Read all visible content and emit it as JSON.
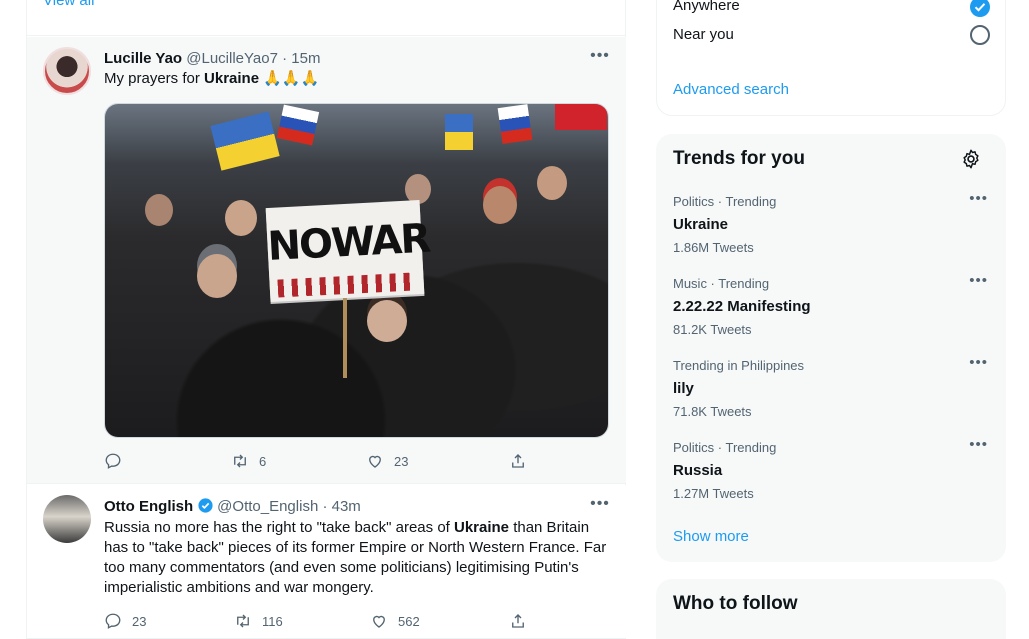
{
  "timeline": {
    "view_all": "View all",
    "tweets": [
      {
        "author": "Lucille Yao",
        "handle": "@LucilleYao7 · 15m",
        "text_before": "My prayers for ",
        "text_bold": "Ukraine",
        "text_after": " 🙏🙏🙏",
        "media": {
          "sign_text": "NOWAR"
        },
        "reply_count": "",
        "retweet_count": "6",
        "like_count": "23"
      },
      {
        "author": "Otto English",
        "handle": "@Otto_English · 43m",
        "verified": true,
        "text_before": "Russia no more has the right to \"take back\" areas of ",
        "text_bold": "Ukraine",
        "text_after": " than Britain has to \"take back\" pieces of its former Empire or North Western France. Far too many commentators (and even some politicians) legitimising Putin's imperialistic ambitions and war mongery.",
        "reply_count": "23",
        "retweet_count": "116",
        "like_count": "562"
      }
    ]
  },
  "search_filters": {
    "options": [
      {
        "label": "Anywhere",
        "selected": true
      },
      {
        "label": "Near you",
        "selected": false
      }
    ],
    "advanced_search": "Advanced search"
  },
  "trends": {
    "title": "Trends for you",
    "items": [
      {
        "meta": "Politics · Trending",
        "name": "Ukraine",
        "count": "1.86M Tweets"
      },
      {
        "meta": "Music · Trending",
        "name": "2.22.22 Manifesting",
        "count": "81.2K Tweets"
      },
      {
        "meta": "Trending in Philippines",
        "name": "lily",
        "count": "71.8K Tweets"
      },
      {
        "meta": "Politics · Trending",
        "name": "Russia",
        "count": "1.27M Tweets"
      }
    ],
    "show_more": "Show more"
  },
  "who_to_follow": {
    "title": "Who to follow"
  },
  "colors": {
    "accent": "#1d9bf0",
    "secondary_text": "#536471",
    "panel_bg": "#f7f9f9"
  },
  "icons": [
    "more-icon",
    "reply-icon",
    "retweet-icon",
    "like-icon",
    "share-icon",
    "verified-icon",
    "gear-icon",
    "check-icon"
  ]
}
